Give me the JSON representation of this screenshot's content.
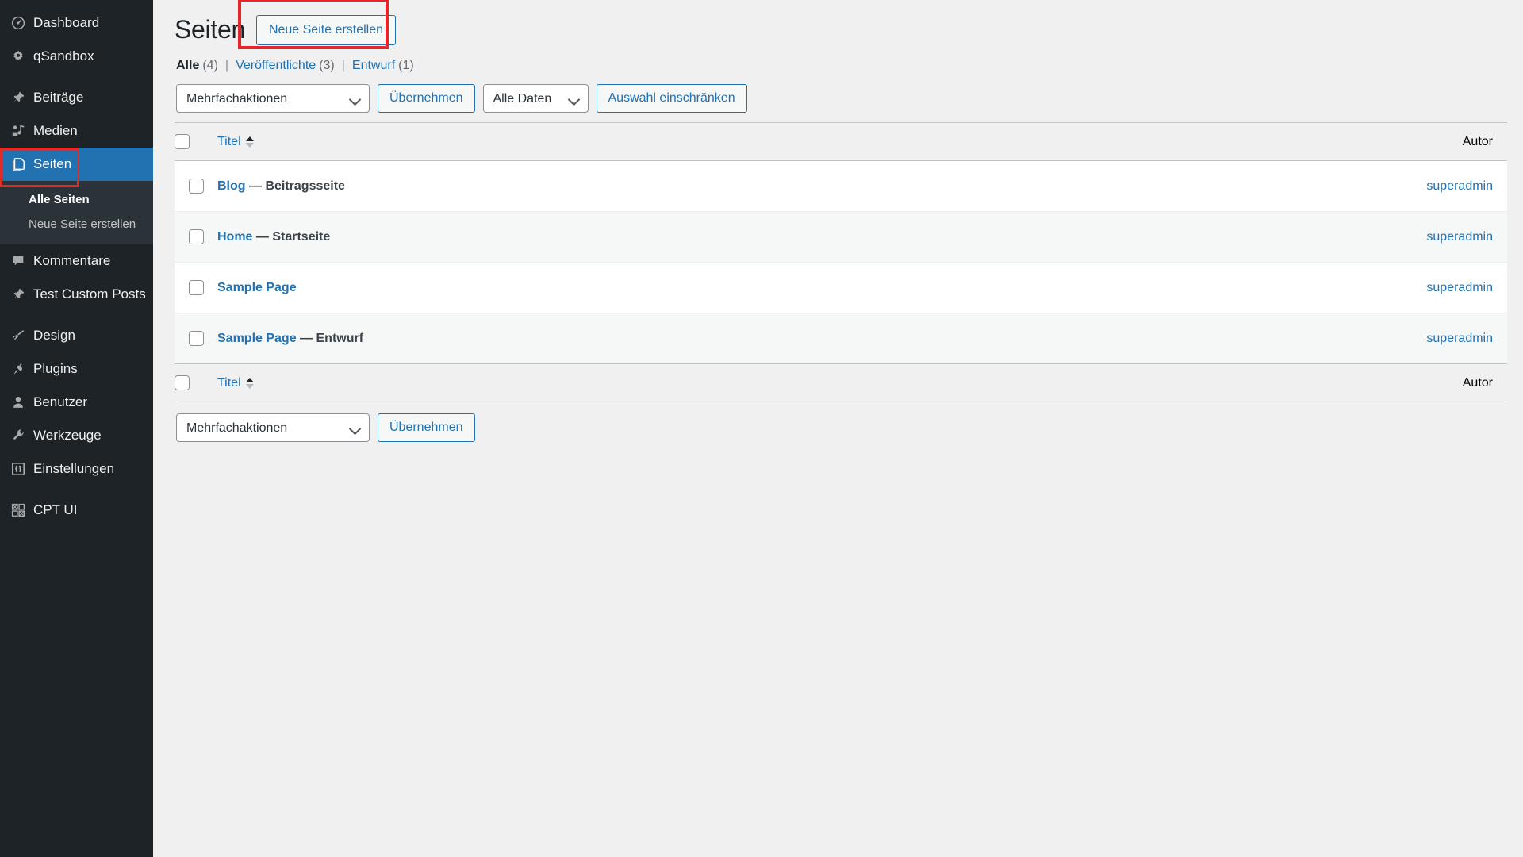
{
  "sidebar": {
    "items": [
      {
        "label": "Dashboard",
        "icon": "dashboard-icon",
        "name": "sidebar-item-dashboard",
        "sep_after": false
      },
      {
        "label": "qSandbox",
        "icon": "gear-icon",
        "name": "sidebar-item-qsandbox",
        "sep_after": true
      },
      {
        "label": "Beiträge",
        "icon": "pin-icon",
        "name": "sidebar-item-beitraege",
        "sep_after": false
      },
      {
        "label": "Medien",
        "icon": "media-icon",
        "name": "sidebar-item-medien",
        "sep_after": false
      }
    ],
    "current": {
      "label": "Seiten",
      "icon": "pages-icon",
      "name": "sidebar-item-seiten"
    },
    "submenu": [
      {
        "label": "Alle Seiten",
        "active": true,
        "name": "submenu-item-alle-seiten"
      },
      {
        "label": "Neue Seite erstellen",
        "active": false,
        "name": "submenu-item-neue-seite-erstellen"
      }
    ],
    "items_after": [
      {
        "label": "Kommentare",
        "icon": "comment-icon",
        "name": "sidebar-item-kommentare",
        "sep_after": false
      },
      {
        "label": "Test Custom Posts",
        "icon": "pin-icon",
        "name": "sidebar-item-test-custom-posts",
        "sep_after": true
      },
      {
        "label": "Design",
        "icon": "brush-icon",
        "name": "sidebar-item-design",
        "sep_after": false
      },
      {
        "label": "Plugins",
        "icon": "plug-icon",
        "name": "sidebar-item-plugins",
        "sep_after": false
      },
      {
        "label": "Benutzer",
        "icon": "user-icon",
        "name": "sidebar-item-benutzer",
        "sep_after": false
      },
      {
        "label": "Werkzeuge",
        "icon": "wrench-icon",
        "name": "sidebar-item-werkzeuge",
        "sep_after": false
      },
      {
        "label": "Einstellungen",
        "icon": "sliders-icon",
        "name": "sidebar-item-einstellungen",
        "sep_after": true
      },
      {
        "label": "CPT UI",
        "icon": "grid-icon",
        "name": "sidebar-item-cpt-ui",
        "sep_after": false
      }
    ]
  },
  "header": {
    "title": "Seiten",
    "add_new_label": "Neue Seite erstellen"
  },
  "filters": [
    {
      "label": "Alle",
      "count": "(4)",
      "current": true
    },
    {
      "label": "Veröffentlichte",
      "count": "(3)",
      "current": false
    },
    {
      "label": "Entwurf",
      "count": "(1)",
      "current": false
    }
  ],
  "separator": "|",
  "toolbar": {
    "bulk_actions_value": "Mehrfachaktionen",
    "apply_label": "Übernehmen",
    "dates_value": "Alle Daten",
    "filter_label": "Auswahl einschränken"
  },
  "toolbar_bottom": {
    "bulk_actions_value": "Mehrfachaktionen",
    "apply_label": "Übernehmen"
  },
  "table": {
    "columns": {
      "title": "Titel",
      "author": "Autor"
    },
    "rows": [
      {
        "title": "Blog",
        "suffix": "— Beitragsseite",
        "author": "superadmin"
      },
      {
        "title": "Home",
        "suffix": "— Startseite",
        "author": "superadmin"
      },
      {
        "title": "Sample Page",
        "suffix": "",
        "author": "superadmin"
      },
      {
        "title": "Sample Page",
        "suffix": "— Entwurf",
        "author": "superadmin"
      }
    ]
  },
  "colors": {
    "accent": "#2271b1",
    "sidebar_bg": "#1d2327",
    "highlight": "#e8262a"
  }
}
